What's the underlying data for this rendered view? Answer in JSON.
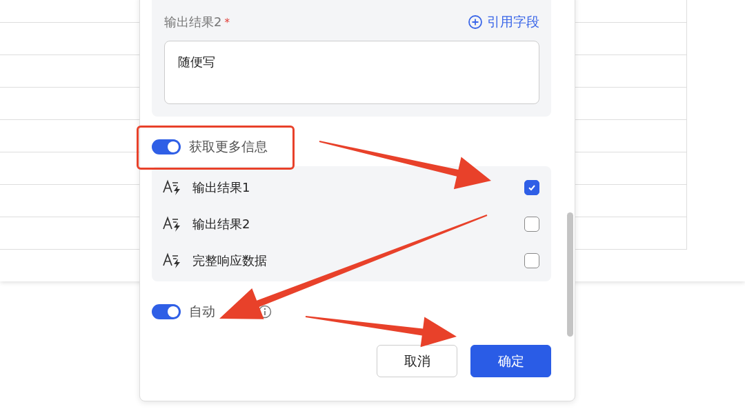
{
  "output_field": {
    "label": "输出结果2",
    "required_mark": "*",
    "action": "引用字段",
    "value": "随便写"
  },
  "more_info_toggle": {
    "label": "获取更多信息",
    "on": true
  },
  "fields": [
    {
      "label": "输出结果1",
      "checked": true
    },
    {
      "label": "输出结果2",
      "checked": false
    },
    {
      "label": "完整响应数据",
      "checked": false
    }
  ],
  "auto_toggle": {
    "label": "自动",
    "on": true
  },
  "buttons": [
    {
      "label": "取消",
      "kind": "secondary"
    },
    {
      "label": "确定",
      "kind": "primary"
    }
  ]
}
